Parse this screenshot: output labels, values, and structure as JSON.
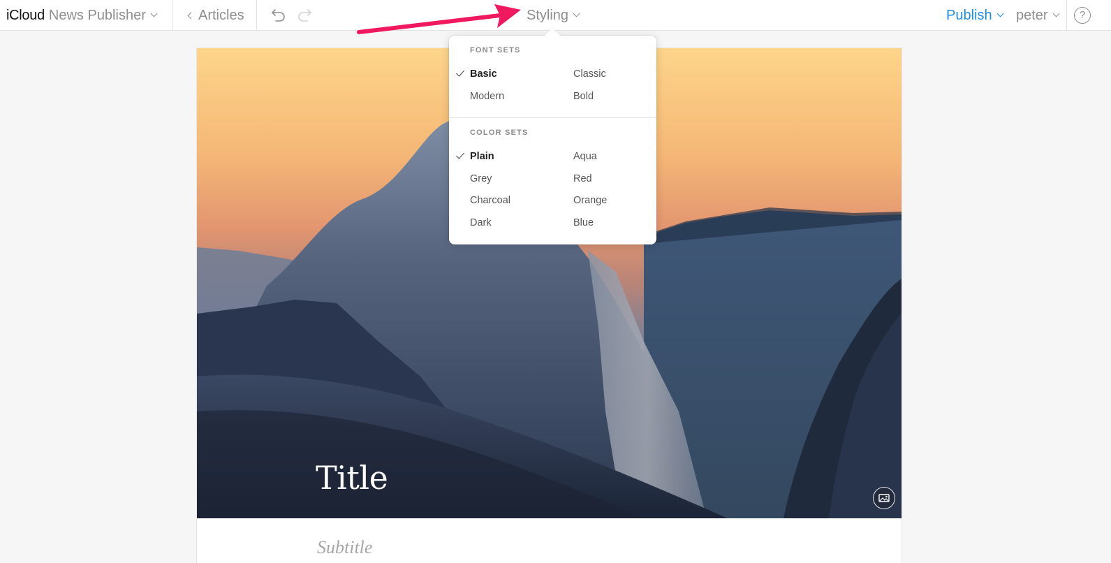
{
  "toolbar": {
    "brand": "iCloud",
    "app_name": "News Publisher",
    "back_label": "Articles",
    "styling_label": "Styling",
    "publish_label": "Publish",
    "user_label": "peter",
    "help_label": "?"
  },
  "styling_menu": {
    "font_sets_title": "FONT SETS",
    "font_sets": [
      {
        "label": "Basic",
        "selected": true
      },
      {
        "label": "Classic",
        "selected": false
      },
      {
        "label": "Modern",
        "selected": false
      },
      {
        "label": "Bold",
        "selected": false
      }
    ],
    "color_sets_title": "COLOR SETS",
    "color_sets": [
      {
        "label": "Plain",
        "selected": true
      },
      {
        "label": "Aqua",
        "selected": false
      },
      {
        "label": "Grey",
        "selected": false
      },
      {
        "label": "Red",
        "selected": false
      },
      {
        "label": "Charcoal",
        "selected": false
      },
      {
        "label": "Orange",
        "selected": false
      },
      {
        "label": "Dark",
        "selected": false
      },
      {
        "label": "Blue",
        "selected": false
      }
    ]
  },
  "article": {
    "title_placeholder": "Title",
    "subtitle_placeholder": "Subtitle"
  },
  "colors": {
    "accent": "#1a8cf0",
    "annotation_arrow": "#f0185f",
    "sky_top": "#fdd58a",
    "sky_mid": "#e79a6e",
    "mountain_dark": "#1e2a3d"
  },
  "icons": {
    "undo": "undo-icon",
    "redo": "redo-icon",
    "help": "help-icon",
    "image": "image-icon"
  }
}
